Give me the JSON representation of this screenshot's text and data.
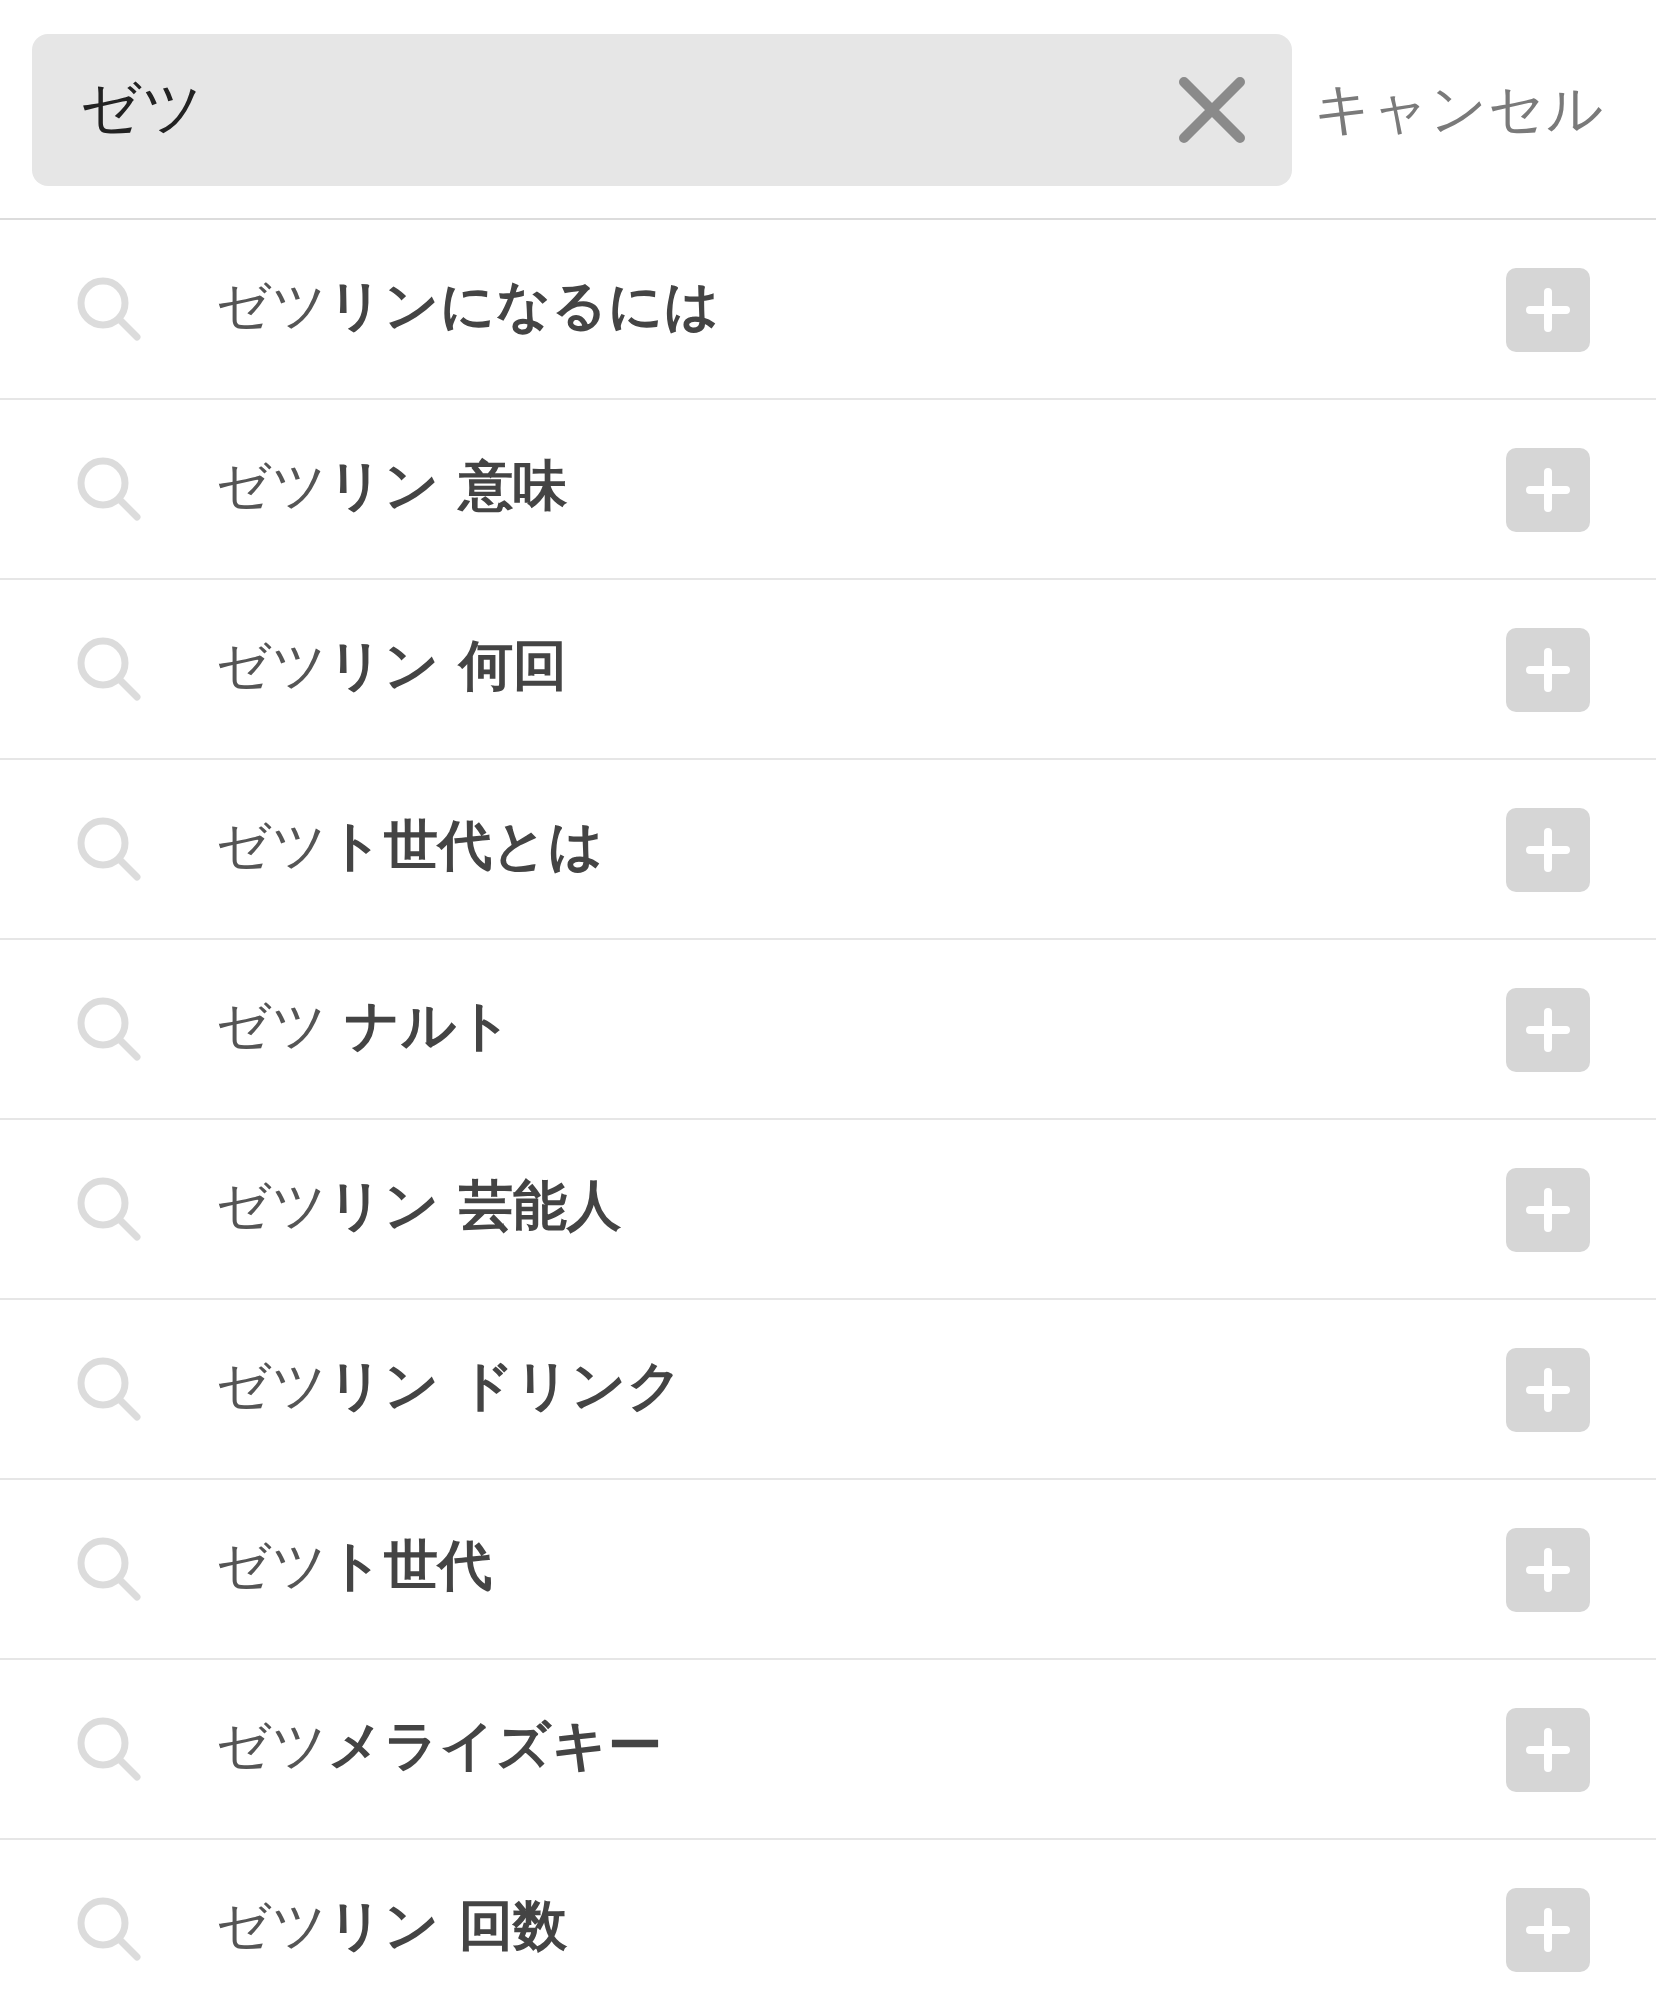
{
  "search": {
    "value": "ゼツ"
  },
  "cancel": "キャンセル",
  "suggestions": [
    {
      "text": "ゼツ**リンになるには**"
    },
    {
      "text": "ゼツ**リン 意味**"
    },
    {
      "text": "ゼツ**リン 何回**"
    },
    {
      "text": "ゼツ**ト世代とは**"
    },
    {
      "text": "ゼツ **ナルト**"
    },
    {
      "text": "ゼツ**リン 芸能人**"
    },
    {
      "text": "ゼツ**リン ドリンク**"
    },
    {
      "text": "ゼツ**ト世代**"
    },
    {
      "text": "ゼツ**メライズキー**"
    },
    {
      "text": "ゼツ**リン 回数**"
    }
  ]
}
